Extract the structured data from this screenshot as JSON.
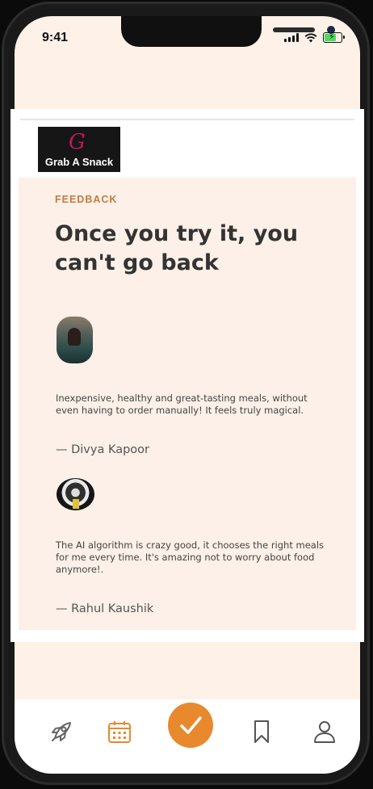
{
  "status_bar": {
    "time": "9:41"
  },
  "brand": {
    "logo_text": "Grab A Snack",
    "logo_mark": "G"
  },
  "feedback": {
    "label": "FEEDBACK",
    "heading": "Once you try it, you can't go back",
    "testimonials": [
      {
        "quote": "Inexpensive, healthy and great-tasting meals, without even having to order manually! It feels truly magical.",
        "author": "— Divya Kapoor"
      },
      {
        "quote": "The AI algorithm is crazy good, it chooses the right meals for me every time. It's amazing not to worry about food anymore!.",
        "author": "— Rahul Kaushik"
      }
    ]
  },
  "tab_bar": {
    "items": [
      {
        "icon": "rocket-icon"
      },
      {
        "icon": "calendar-icon"
      },
      {
        "icon": "checkmark-icon",
        "active": true
      },
      {
        "icon": "bookmark-icon"
      },
      {
        "icon": "profile-icon"
      }
    ],
    "accent_color": "#e8892d"
  },
  "colors": {
    "page_background": "#fdf1e8",
    "label_color": "#c77a3c"
  }
}
